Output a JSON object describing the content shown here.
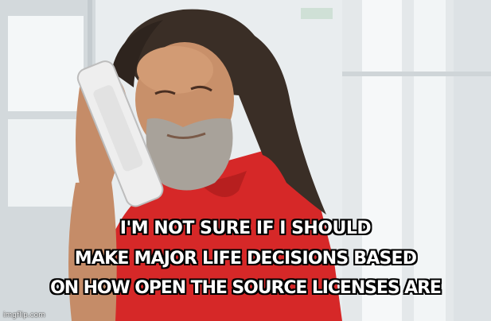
{
  "meme": {
    "caption_lines": [
      "I'M NOT SURE IF I SHOULD",
      "MAKE MAJOR LIFE DECISIONS BASED",
      "ON HOW OPEN THE SOURCE LICENSES ARE"
    ],
    "watermark": "imgflip.com"
  },
  "colors": {
    "shirt": "#d62828",
    "hair": "#3a2e26",
    "skin": "#c8906a",
    "beard": "#a8a29a",
    "phone": "#eeeeee",
    "caption_text": "#ffffff",
    "caption_outline": "#000000"
  }
}
